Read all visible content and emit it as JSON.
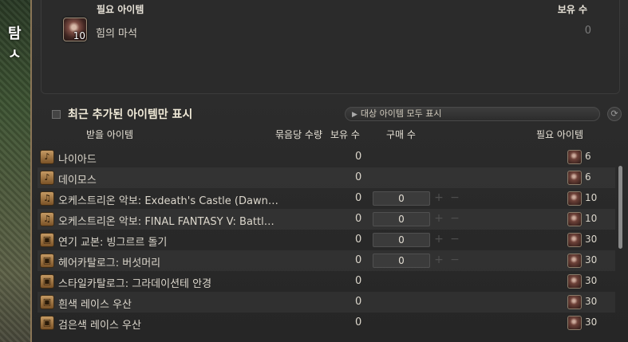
{
  "background": {
    "partial_tab_text": "탐ㅅ"
  },
  "required_panel": {
    "header_label": "필요 아이템",
    "owned_header_label": "보유 수",
    "item": {
      "name": "힘의 마석",
      "quantity_badge": "10",
      "owned": "0"
    }
  },
  "filter": {
    "recent_only_label": "최근 추가된 아이템만 표시",
    "show_all_label": "대상 아이템 모두 표시",
    "refresh_icon": "refresh-icon"
  },
  "columns": {
    "receive_item": "받을 아이템",
    "per_bundle": "묶음당 수량",
    "owned": "보유 수",
    "purchase": "구매 수",
    "required_item": "필요 아이템"
  },
  "rows": [
    {
      "icon": "♪",
      "name": "나이아드",
      "owned": "0",
      "purchase": "",
      "required": "6"
    },
    {
      "icon": "♪",
      "name": "데이모스",
      "owned": "0",
      "purchase": "",
      "required": "6"
    },
    {
      "icon": "♫",
      "name": "오케스트리온 악보: Exdeath's Castle (Dawn…",
      "owned": "0",
      "purchase": "0",
      "required": "10"
    },
    {
      "icon": "♫",
      "name": "오케스트리온 악보: FINAL FANTASY V: Battl…",
      "owned": "0",
      "purchase": "0",
      "required": "10"
    },
    {
      "icon": "▣",
      "name": "연기 교본: 빙그르르 돌기",
      "owned": "0",
      "purchase": "0",
      "required": "30"
    },
    {
      "icon": "▣",
      "name": "헤어카탈로그: 버섯머리",
      "owned": "0",
      "purchase": "0",
      "required": "30"
    },
    {
      "icon": "▣",
      "name": "스타일카탈로그: 그라데이션테 안경",
      "owned": "0",
      "purchase": "",
      "required": "30"
    },
    {
      "icon": "▣",
      "name": "흰색 레이스 우산",
      "owned": "0",
      "purchase": "",
      "required": "30"
    },
    {
      "icon": "▣",
      "name": "검은색 레이스 우산",
      "owned": "0",
      "purchase": "",
      "required": "30"
    }
  ],
  "step_labels": {
    "plus": "+",
    "minus": "−"
  }
}
